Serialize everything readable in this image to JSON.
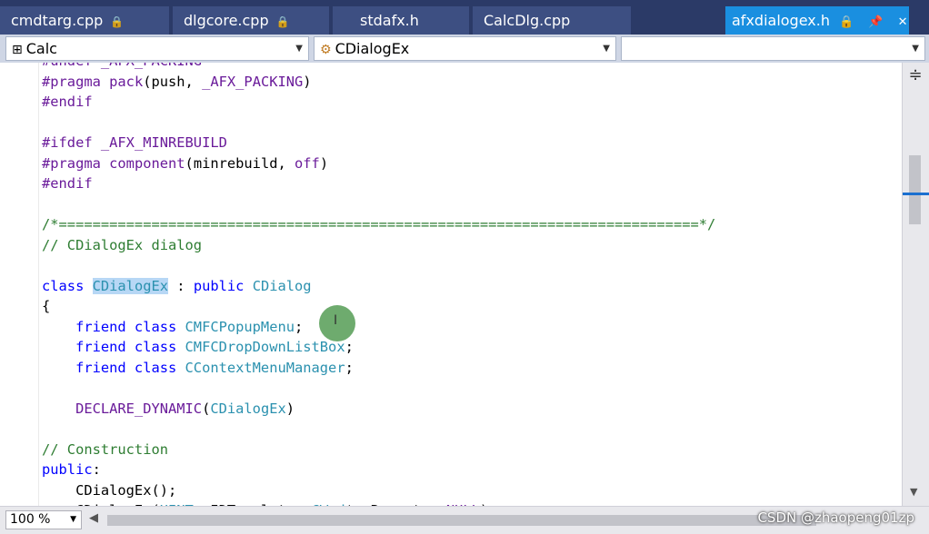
{
  "tabs": [
    {
      "label": "cmdtarg.cpp",
      "lock": "🔒"
    },
    {
      "label": "dlgcore.cpp",
      "lock": "🔒"
    },
    {
      "label": "stdafx.h",
      "lock": ""
    },
    {
      "label": "CalcDlg.cpp",
      "lock": ""
    }
  ],
  "active_tab": {
    "label": "afxdialogex.h",
    "icons": "🔒 📌 ✕"
  },
  "nav": {
    "project": "Calc",
    "class": "CDialogEx",
    "member": ""
  },
  "code_lines": [
    [
      {
        "t": "#undef _AFX_PACKING",
        "c": "pp"
      }
    ],
    [
      {
        "t": "#pragma ",
        "c": "pp"
      },
      {
        "t": "pack",
        "c": "pp"
      },
      {
        "t": "(push, ",
        "c": ""
      },
      {
        "t": "_AFX_PACKING",
        "c": "mac"
      },
      {
        "t": ")",
        "c": ""
      }
    ],
    [
      {
        "t": "#endif",
        "c": "pp"
      }
    ],
    [],
    [
      {
        "t": "#ifdef ",
        "c": "pp"
      },
      {
        "t": "_AFX_MINREBUILD",
        "c": "mac"
      }
    ],
    [
      {
        "t": "#pragma ",
        "c": "pp"
      },
      {
        "t": "component",
        "c": "pp"
      },
      {
        "t": "(minrebuild, ",
        "c": ""
      },
      {
        "t": "off",
        "c": "pp"
      },
      {
        "t": ")",
        "c": ""
      }
    ],
    [
      {
        "t": "#endif",
        "c": "pp"
      }
    ],
    [],
    [
      {
        "t": "/*============================================================================*/",
        "c": "cm"
      }
    ],
    [
      {
        "t": "// CDialogEx dialog",
        "c": "cm"
      }
    ],
    [],
    [
      {
        "t": "class ",
        "c": "kw"
      },
      {
        "t": "CDialogEx",
        "c": "ty hl"
      },
      {
        "t": " : ",
        "c": ""
      },
      {
        "t": "public ",
        "c": "kw"
      },
      {
        "t": "CDialog",
        "c": "ty"
      }
    ],
    [
      {
        "t": "{",
        "c": ""
      }
    ],
    [
      {
        "t": "    friend class ",
        "c": "kw"
      },
      {
        "t": "CMFCPopupMenu",
        "c": "ty"
      },
      {
        "t": ";",
        "c": ""
      }
    ],
    [
      {
        "t": "    friend class ",
        "c": "kw"
      },
      {
        "t": "CMFCDropDownListBox",
        "c": "ty"
      },
      {
        "t": ";",
        "c": ""
      }
    ],
    [
      {
        "t": "    friend class ",
        "c": "kw"
      },
      {
        "t": "CContextMenuManager",
        "c": "ty"
      },
      {
        "t": ";",
        "c": ""
      }
    ],
    [],
    [
      {
        "t": "    DECLARE_DYNAMIC",
        "c": "mac"
      },
      {
        "t": "(",
        "c": ""
      },
      {
        "t": "CDialogEx",
        "c": "ty"
      },
      {
        "t": ")",
        "c": ""
      }
    ],
    [],
    [
      {
        "t": "// Construction",
        "c": "cm"
      }
    ],
    [
      {
        "t": "public",
        "c": "kw"
      },
      {
        "t": ":",
        "c": ""
      }
    ],
    [
      {
        "t": "    CDialogEx();",
        "c": ""
      }
    ],
    [
      {
        "t": "    CDialogEx(",
        "c": ""
      },
      {
        "t": "UINT",
        "c": "ty"
      },
      {
        "t": " nIDTemplate, ",
        "c": ""
      },
      {
        "t": "CWnd",
        "c": "ty"
      },
      {
        "t": "* pParent = ",
        "c": ""
      },
      {
        "t": "NULL",
        "c": "mac"
      },
      {
        "t": ");",
        "c": ""
      }
    ]
  ],
  "zoom": "100 %",
  "watermark": "CSDN @zhaopeng01zp",
  "icons": {
    "split": "split-icon",
    "scroll_down": "chevron-down-icon",
    "scroll_left": "chevron-left-icon"
  },
  "colors": {
    "accent": "#1a8fe0",
    "frame": "#2b3a67",
    "keyword": "#0000ff",
    "preprocessor": "#6a1b9a",
    "comment": "#2e7d32",
    "type": "#2b91af"
  }
}
